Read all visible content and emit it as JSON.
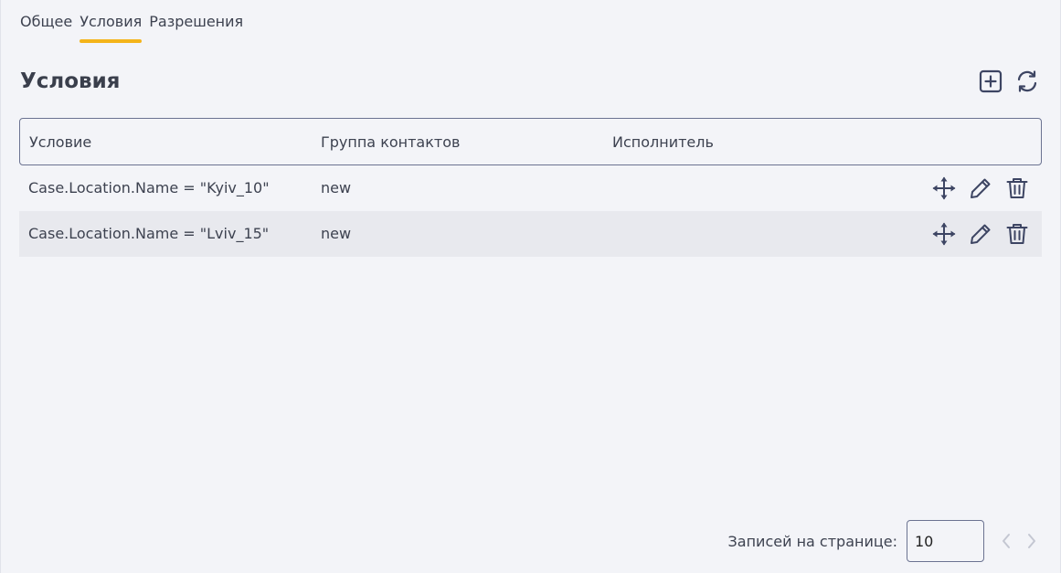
{
  "tabs": [
    {
      "label": "Общее"
    },
    {
      "label": "Условия"
    },
    {
      "label": "Разрешения"
    }
  ],
  "active_tab": "Условия",
  "page_title": "Условия",
  "actions": {
    "add_icon": "add-square-icon",
    "refresh_icon": "refresh-icon"
  },
  "table": {
    "headers": [
      "Условие",
      "Группа контактов",
      "Исполнитель"
    ],
    "rows": [
      {
        "condition": "Case.Location.Name = \"Kyiv_10\"",
        "group": "new",
        "executor": ""
      },
      {
        "condition": "Case.Location.Name = \"Lviv_15\"",
        "group": "new",
        "executor": ""
      }
    ],
    "row_action_icons": [
      "move-icon",
      "edit-pencil-icon",
      "trash-icon"
    ]
  },
  "pagination": {
    "label": "Записей на странице:",
    "page_size": "10"
  },
  "colors": {
    "accent": "#f4b41a",
    "background": "#f3f4f8",
    "icon": "#3d4563",
    "border": "#6b7391"
  }
}
